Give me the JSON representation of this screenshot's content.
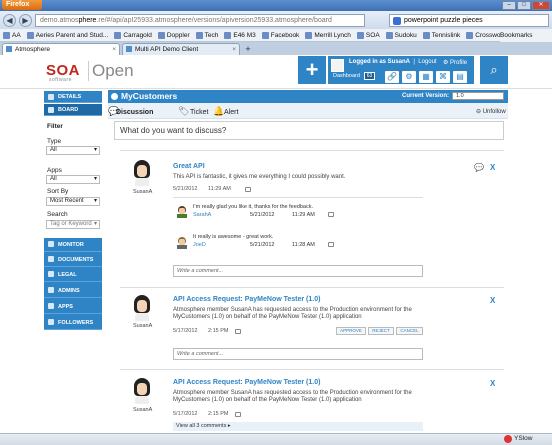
{
  "browser": {
    "app_button": "Firefox",
    "url_prefix": "demo.atmos",
    "url_host": "phere",
    "url_rest": ".re/#/api/apI25933.atmosphere/versions/apiversion25933.atmosphere/board",
    "search_value": "powerpoint puzzle pieces",
    "bookmarks": [
      "AA",
      "Aeries Parent and Stud...",
      "Carragold",
      "Doppler",
      "Tech",
      "E46 M3",
      "Facebook",
      "Merrill Lynch",
      "SOA",
      "Sudoku",
      "Tennislink",
      "Crossword"
    ],
    "bookmarks_right": "Bookmarks",
    "tabs": [
      {
        "label": "Atmosphere"
      },
      {
        "label": "Multi API Demo Client"
      }
    ],
    "status_right": "YSlow"
  },
  "header": {
    "logo": "SOA",
    "logo_sub": "software",
    "app_name": "Open",
    "plus": "+",
    "logged_in": "Logged in as SusanA",
    "logout": "Logout",
    "profile": "Profile",
    "dashboard": "Dashboard",
    "dashboard_count": "63"
  },
  "sidebar": {
    "details": "DETAILS",
    "board": "BOARD",
    "filter": "Filter",
    "type_label": "Type",
    "type_value": "All",
    "apps_label": "Apps",
    "apps_value": "All",
    "sortby_label": "Sort By",
    "sortby_value": "Most Recent",
    "search_label": "Search",
    "search_placeholder": "Tag or Keyword",
    "nav": [
      "MONITOR",
      "DOCUMENTS",
      "LEGAL",
      "ADMINS",
      "APPS",
      "FOLLOWERS"
    ]
  },
  "main": {
    "title": "MyCustomers",
    "current_version_label": "Current Version:",
    "current_version": "1.0",
    "tab_discussion": "Discussion",
    "tab_ticket": "Ticket",
    "tab_alert": "Alert",
    "unfollow": "Unfollow",
    "discuss_prompt": "What do you want to discuss?",
    "comment_placeholder": "Write a comment...",
    "posts": [
      {
        "user": "SusanA",
        "title": "Great API",
        "text": "This API is fantastic, it gives me everything I could possibly want.",
        "date": "5/21/2012",
        "time": "11:29 AM",
        "replies": [
          {
            "text": "I'm really glad you like it, thanks for the feedback.",
            "user": "SarahA",
            "date": "5/21/2012",
            "time": "11:29 AM"
          },
          {
            "text": "It really is awesome - great work.",
            "user": "JoeD",
            "date": "5/21/2012",
            "time": "11:28 AM"
          }
        ]
      },
      {
        "user": "SusanA",
        "title": "API Access Request: PayMeNow Tester (1.0)",
        "text1": "Atmosphere member SusanA has requested access to the Production environment for the",
        "text2": "MyCustomers (1.0) on behalf of the PayMeNow Tester (1.0) application",
        "date": "5/17/2012",
        "time": "2:15 PM",
        "approve": "APPROVE",
        "reject": "REJECT",
        "cancel": "CANCEL"
      },
      {
        "user": "SusanA",
        "title": "API Access Request: PayMeNow Tester (1.0)",
        "text1": "Atmosphere member SusanA has requested access to the Production environment for the",
        "text2": "MyCustomers (1.0) on behalf of the PayMeNow Tester (1.0) application",
        "date": "5/17/2012",
        "time": "2:15 PM",
        "view_all": "View all 3 comments ▸"
      }
    ],
    "close_x": "X"
  }
}
